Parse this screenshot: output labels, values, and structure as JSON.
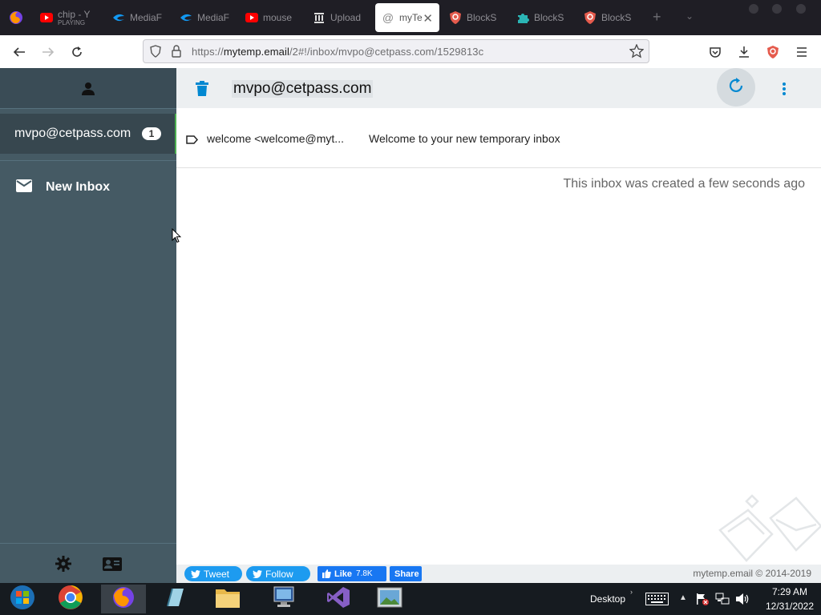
{
  "browser": {
    "tabs": [
      {
        "label": "chip - Y",
        "sub": "PLAYING",
        "icon": "youtube-icon"
      },
      {
        "label": "MediaF",
        "icon": "mediafire-icon"
      },
      {
        "label": "MediaF",
        "icon": "mediafire-icon"
      },
      {
        "label": "mouse",
        "icon": "youtube-icon"
      },
      {
        "label": "Upload",
        "icon": "archive-icon"
      },
      {
        "label": "myTe",
        "icon": "at-icon",
        "active": true
      },
      {
        "label": "BlockS",
        "icon": "shield-icon"
      },
      {
        "label": "BlockS",
        "icon": "puzzle-icon"
      },
      {
        "label": "BlockS",
        "icon": "shield-icon"
      }
    ],
    "url_prefix": "https://",
    "url_domain": "mytemp.email",
    "url_path": "/2#!/inbox/mvpo@cetpass.com/1529813c"
  },
  "sidebar": {
    "account": "mvpo@cetpass.com",
    "badge": "1",
    "new_inbox_label": "New Inbox"
  },
  "main": {
    "title": "mvpo@cetpass.com",
    "mail": {
      "from": "welcome <welcome@myt...",
      "subject": "Welcome to your new temporary inbox"
    },
    "created_note": "This inbox was created a few seconds ago"
  },
  "footer": {
    "tweet_label": "Tweet",
    "follow_label": "Follow",
    "like_label": "Like",
    "like_count": "7.8K",
    "share_label": "Share",
    "copyright": "mytemp.email © 2014-2019"
  },
  "taskbar": {
    "desktop_label": "Desktop",
    "time": "7:29 AM",
    "date": "12/31/2022"
  },
  "colors": {
    "sidebar_bg": "#455a64",
    "accent": "#0288d1",
    "active_border": "#4caf50"
  }
}
